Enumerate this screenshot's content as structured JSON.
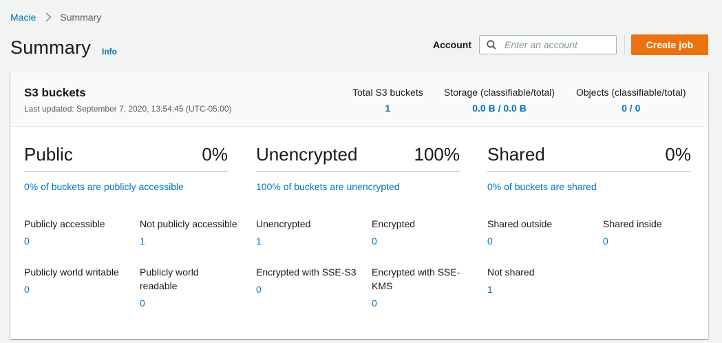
{
  "breadcrumb": {
    "root": "Macie",
    "current": "Summary"
  },
  "page": {
    "title": "Summary",
    "info": "Info"
  },
  "account": {
    "label": "Account",
    "placeholder": "Enter an account",
    "value": ""
  },
  "actions": {
    "create_job": "Create job"
  },
  "colors": {
    "accent": "#0073bb",
    "primary_button": "#ec7211"
  },
  "panel": {
    "title": "S3 buckets",
    "last_updated": "Last updated: September 7, 2020, 13:54:45 (UTC-05:00)",
    "stats": [
      {
        "label": "Total S3 buckets",
        "value": "1"
      },
      {
        "label": "Storage (classifiable/total)",
        "value": "0.0 B / 0.0 B"
      },
      {
        "label": "Objects (classifiable/total)",
        "value": "0 / 0"
      }
    ]
  },
  "sections": [
    {
      "title": "Public",
      "percent": "0%",
      "link": "0% of buckets are publicly accessible",
      "metrics": [
        {
          "label": "Publicly accessible",
          "value": "0"
        },
        {
          "label": "Not publicly accessible",
          "value": "1"
        },
        {
          "label": "Publicly world writable",
          "value": "0"
        },
        {
          "label": "Publicly world readable",
          "value": "0"
        }
      ]
    },
    {
      "title": "Unencrypted",
      "percent": "100%",
      "link": "100% of buckets are unencrypted",
      "metrics": [
        {
          "label": "Unencrypted",
          "value": "1"
        },
        {
          "label": "Encrypted",
          "value": "0"
        },
        {
          "label": "Encrypted with SSE-S3",
          "value": "0"
        },
        {
          "label": "Encrypted with SSE-KMS",
          "value": "0"
        }
      ]
    },
    {
      "title": "Shared",
      "percent": "0%",
      "link": "0% of buckets are shared",
      "metrics": [
        {
          "label": "Shared outside",
          "value": "0"
        },
        {
          "label": "Shared inside",
          "value": "0"
        },
        {
          "label": "Not shared",
          "value": "1"
        }
      ]
    }
  ]
}
